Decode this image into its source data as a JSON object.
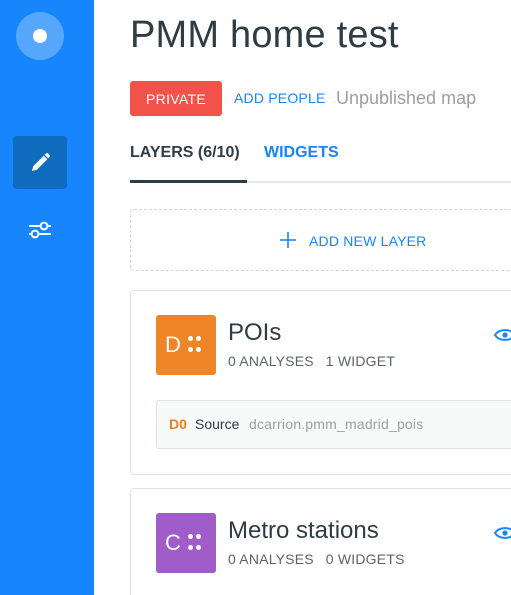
{
  "sidebar": {
    "logo_icon": "carto-logo-icon",
    "items": [
      {
        "icon": "pencil-icon",
        "active": true
      },
      {
        "icon": "sliders-icon",
        "active": false
      }
    ]
  },
  "header": {
    "title": "PMM home test",
    "privacy_label": "PRIVATE",
    "add_people_label": "ADD PEOPLE",
    "status_text": "Unpublished map"
  },
  "tabs": [
    {
      "label": "LAYERS (6/10)",
      "active": true
    },
    {
      "label": "WIDGETS",
      "active": false
    }
  ],
  "add_layer": {
    "label": "ADD NEW LAYER",
    "icon": "plus-icon"
  },
  "layers": [
    {
      "letter": "D",
      "color": "#f08527",
      "name": "POIs",
      "analyses": "0 ANALYSES",
      "widgets": "1 WIDGET",
      "source": {
        "id": "D0",
        "label": "Source",
        "value": "dcarrion.pmm_madrid_pois"
      }
    },
    {
      "letter": "C",
      "color": "#a05cc9",
      "name": "Metro stations",
      "analyses": "0 ANALYSES",
      "widgets": "0 WIDGETS"
    }
  ],
  "colors": {
    "sidebar": "#1785fb",
    "accent": "#1785fb",
    "private": "#f3524b",
    "source_id": "#f07e1b"
  }
}
